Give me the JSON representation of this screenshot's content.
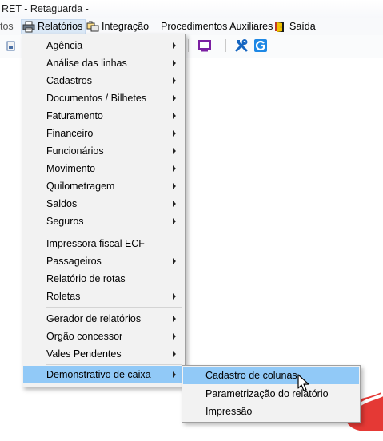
{
  "window": {
    "title": "RET - Retaguarda -"
  },
  "menubar": {
    "items": [
      {
        "label": "tos"
      },
      {
        "label": "Relatórios"
      },
      {
        "label": "Integração"
      },
      {
        "label": "Procedimentos Auxiliares"
      },
      {
        "label": "Saída"
      }
    ]
  },
  "toolbar": {
    "icons": [
      "document-icon",
      "monitor-icon",
      "tools-icon",
      "g-app-icon"
    ]
  },
  "relatorios_menu": {
    "items": [
      {
        "label": "Agência",
        "has_submenu": true
      },
      {
        "label": "Análise das linhas",
        "has_submenu": true
      },
      {
        "label": "Cadastros",
        "has_submenu": true
      },
      {
        "label": "Documentos / Bilhetes",
        "has_submenu": true
      },
      {
        "label": "Faturamento",
        "has_submenu": true
      },
      {
        "label": "Financeiro",
        "has_submenu": true
      },
      {
        "label": "Funcionários",
        "has_submenu": true
      },
      {
        "label": "Movimento",
        "has_submenu": true
      },
      {
        "label": "Quilometragem",
        "has_submenu": true
      },
      {
        "label": "Saldos",
        "has_submenu": true
      },
      {
        "label": "Seguros",
        "has_submenu": true
      },
      {
        "label": "Impressora fiscal ECF",
        "has_submenu": false
      },
      {
        "label": "Passageiros",
        "has_submenu": true
      },
      {
        "label": "Relatório de rotas",
        "has_submenu": false
      },
      {
        "label": "Roletas",
        "has_submenu": true
      },
      {
        "label": "Gerador de relatórios",
        "has_submenu": true
      },
      {
        "label": "Orgão concessor",
        "has_submenu": true
      },
      {
        "label": "Vales Pendentes",
        "has_submenu": true
      },
      {
        "label": "Demonstrativo de caixa",
        "has_submenu": true
      }
    ],
    "highlighted": "Demonstrativo de caixa"
  },
  "demonstrativo_submenu": {
    "items": [
      {
        "label": "Cadastro de colunas"
      },
      {
        "label": "Parametrização do relatório"
      },
      {
        "label": "Impressão"
      }
    ],
    "highlighted": "Cadastro de colunas"
  },
  "colors": {
    "highlight": "#91c9f7",
    "menu_bg": "#f2f2f2",
    "border": "#a0a0a0"
  }
}
